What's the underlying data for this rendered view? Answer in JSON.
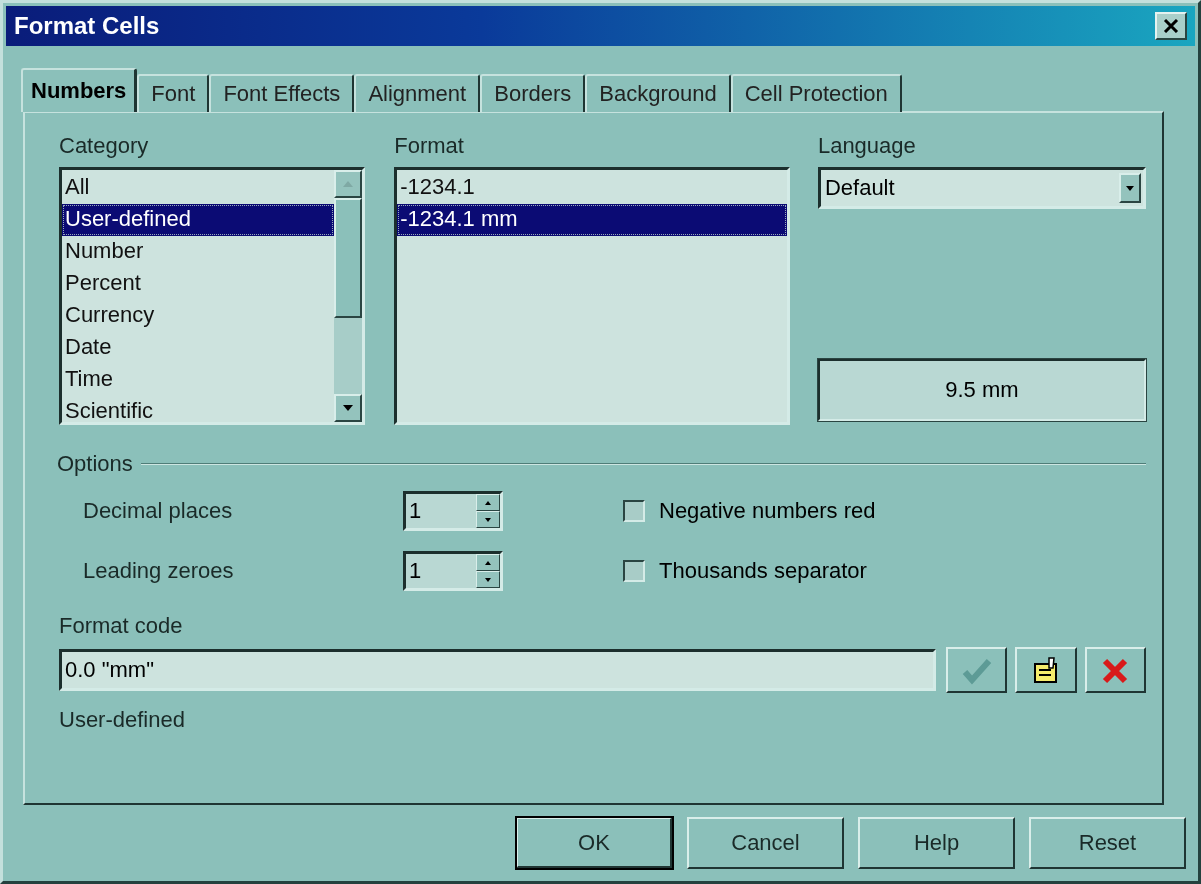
{
  "window": {
    "title": "Format Cells"
  },
  "tabs": [
    {
      "label": "Numbers",
      "selected": true
    },
    {
      "label": "Font",
      "selected": false
    },
    {
      "label": "Font Effects",
      "selected": false
    },
    {
      "label": "Alignment",
      "selected": false
    },
    {
      "label": "Borders",
      "selected": false
    },
    {
      "label": "Background",
      "selected": false
    },
    {
      "label": "Cell Protection",
      "selected": false
    }
  ],
  "category": {
    "label": "Category",
    "items": [
      {
        "label": "All",
        "selected": false
      },
      {
        "label": "User-defined",
        "selected": true
      },
      {
        "label": "Number",
        "selected": false
      },
      {
        "label": "Percent",
        "selected": false
      },
      {
        "label": "Currency",
        "selected": false
      },
      {
        "label": "Date",
        "selected": false
      },
      {
        "label": "Time",
        "selected": false
      },
      {
        "label": "Scientific",
        "selected": false
      }
    ]
  },
  "format": {
    "label": "Format",
    "items": [
      {
        "label": "-1234.1",
        "selected": false
      },
      {
        "label": "-1234.1 mm",
        "selected": true
      }
    ]
  },
  "language": {
    "label": "Language",
    "value": "Default"
  },
  "preview": "9.5 mm",
  "options": {
    "label": "Options",
    "spinners": [
      {
        "label": "Decimal places",
        "value": "1"
      },
      {
        "label": "Leading zeroes",
        "value": "1"
      }
    ],
    "checkboxes": [
      {
        "label": "Negative numbers red",
        "checked": false
      },
      {
        "label": "Thousands separator",
        "checked": false
      }
    ]
  },
  "format_code": {
    "label": "Format code",
    "value": "0.0 \"mm\""
  },
  "tool_buttons": [
    {
      "kind": "add",
      "disabled": true
    },
    {
      "kind": "comment",
      "disabled": false
    },
    {
      "kind": "delete",
      "disabled": false
    }
  ],
  "description": "User-defined",
  "buttons": [
    {
      "label": "OK",
      "default": true
    },
    {
      "label": "Cancel",
      "default": false
    },
    {
      "label": "Help",
      "default": false
    },
    {
      "label": "Reset",
      "default": false
    }
  ]
}
